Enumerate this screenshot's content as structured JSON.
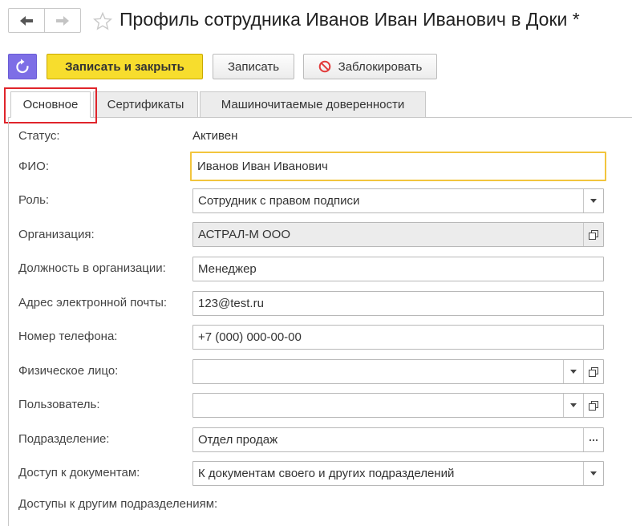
{
  "window": {
    "title": "Профиль сотрудника Иванов Иван Иванович в Доки *"
  },
  "toolbar": {
    "save_close_label": "Записать и закрыть",
    "save_label": "Записать",
    "block_label": "Заблокировать"
  },
  "tabs": [
    {
      "label": "Основное",
      "active": true
    },
    {
      "label": "Сертификаты",
      "active": false
    },
    {
      "label": "Машиночитаемые доверенности",
      "active": false
    }
  ],
  "form": {
    "status": {
      "label": "Статус:",
      "value": "Активен"
    },
    "fio": {
      "label": "ФИО:",
      "value": "Иванов Иван Иванович"
    },
    "role": {
      "label": "Роль:",
      "value": "Сотрудник с правом подписи"
    },
    "organization": {
      "label": "Организация:",
      "value": "АСТРАЛ-М ООО"
    },
    "position": {
      "label": "Должность в организации:",
      "value": "Менеджер"
    },
    "email": {
      "label": "Адрес электронной почты:",
      "value": "123@test.ru"
    },
    "phone": {
      "label": "Номер телефона:",
      "value": "+7 (000) 000-00-00"
    },
    "individual": {
      "label": "Физическое лицо:",
      "value": ""
    },
    "user": {
      "label": "Пользователь:",
      "value": ""
    },
    "department": {
      "label": "Подразделение:",
      "value": "Отдел продаж"
    },
    "doc_access": {
      "label": "Доступ к документам:",
      "value": "К документам своего и других подразделений"
    },
    "other_access": {
      "label": "Доступы к другим подразделениям:"
    }
  },
  "colors": {
    "primary_button": "#f7dd2d",
    "refresh_button": "#7d6ee6",
    "focus_border": "#f2c53d",
    "highlight": "#e0252b"
  }
}
